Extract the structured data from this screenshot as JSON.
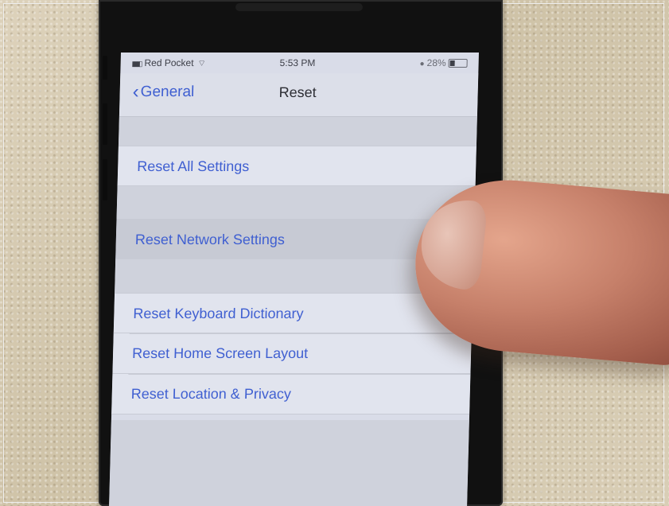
{
  "status_bar": {
    "carrier": "Red Pocket",
    "time": "5:53 PM",
    "battery_percent": "28%"
  },
  "nav": {
    "back_label": "General",
    "title": "Reset"
  },
  "reset_options": [
    "Reset All Settings",
    "Reset Network Settings",
    "Reset Keyboard Dictionary",
    "Reset Home Screen Layout",
    "Reset Location & Privacy"
  ],
  "icons": {
    "back": "chevron-left-icon",
    "wifi": "wifi-icon",
    "battery": "battery-icon",
    "lock": "orientation-lock-icon",
    "signal": "signal-bars-icon"
  },
  "colors": {
    "ios_blue": "#3f5fd1",
    "cell_background": "#e1e4ee",
    "group_background": "#cfd2dc"
  },
  "battery_level": 0.28
}
